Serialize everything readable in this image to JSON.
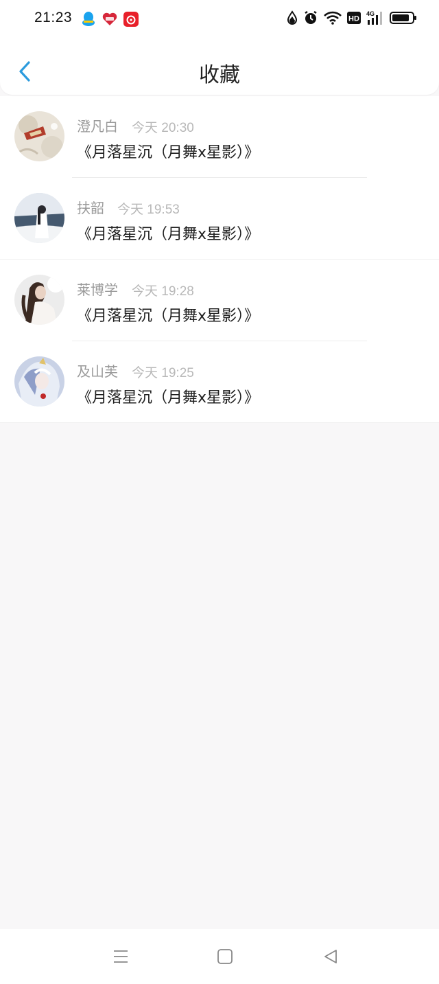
{
  "status_bar": {
    "time": "21:23",
    "notifications": [
      "qq-icon",
      "app-badge-icon",
      "netease-music-icon"
    ],
    "system": [
      "data-saver-icon",
      "alarm-icon",
      "wifi-icon",
      "hd-icon",
      "signal-4g-icon",
      "battery-icon"
    ],
    "hd_label": "HD",
    "network_label": "4G"
  },
  "header": {
    "back_icon": "chevron-left-icon",
    "title": "收藏"
  },
  "colors": {
    "accent": "#2c9bdd",
    "name_text": "#9a9a9a",
    "time_text": "#b8b8b8",
    "title_text": "#1f1f1f",
    "page_bg": "#f8f7f8"
  },
  "favorites": [
    {
      "name": "澄凡白",
      "time": "今天 20:30",
      "title": "《月落星沉（月舞x星影）》",
      "avatar": "avatar-illustration"
    },
    {
      "name": "扶韶",
      "time": "今天 19:53",
      "title": "《月落星沉（月舞x星影）》",
      "avatar": "avatar-seaside-girl"
    },
    {
      "name": "莱博学",
      "time": "今天 19:28",
      "title": "《月落星沉（月舞x星影）》",
      "avatar": "avatar-portrait-girl"
    },
    {
      "name": "及山芙",
      "time": "今天 19:25",
      "title": "《月落星沉（月舞x星影）》",
      "avatar": "avatar-anime-character"
    }
  ],
  "navbar": {
    "buttons": [
      "menu-icon",
      "home-square-icon",
      "back-triangle-icon"
    ]
  }
}
